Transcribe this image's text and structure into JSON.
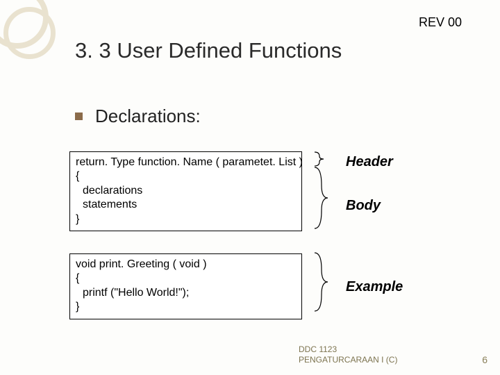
{
  "rev": "REV 00",
  "title": "3. 3 User Defined Functions",
  "bullet": "Declarations:",
  "code1": {
    "l1": "return. Type function. Name ( parametet. List )",
    "l2": "{",
    "l3": "declarations",
    "l4": "statements",
    "l5": "}"
  },
  "code2": {
    "l1": "void print. Greeting ( void )",
    "l2": "{",
    "l3": "printf (\"Hello World!\");",
    "l4": "}"
  },
  "labels": {
    "header": "Header",
    "body": "Body",
    "example": "Example"
  },
  "footer": {
    "l1": "DDC 1123",
    "l2": "PENGATURCARAAN I (C)"
  },
  "slidenum": "6"
}
